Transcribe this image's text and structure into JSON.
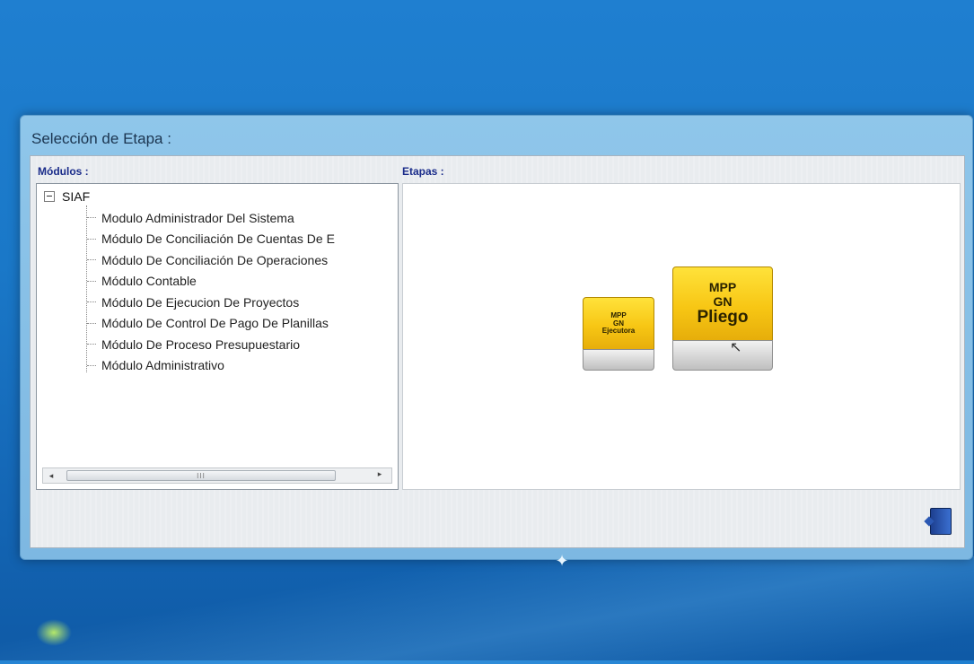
{
  "window": {
    "title": "Selección de Etapa :"
  },
  "modules_panel": {
    "label": "Módulos :",
    "root": "SIAF",
    "items": [
      "Modulo Administrador Del Sistema",
      "Módulo De Conciliación De Cuentas De E",
      "Módulo De Conciliación De Operaciones",
      "Módulo Contable",
      "Módulo De Ejecucion De Proyectos",
      "Módulo De Control De Pago De Planillas",
      "Módulo De Proceso Presupuestario",
      "Módulo Administrativo"
    ],
    "scrollbar": {
      "left_arrow": "◂",
      "thumb_grip": "III",
      "right_arrow": "▸"
    }
  },
  "stages_panel": {
    "label": "Etapas :",
    "buttons": [
      {
        "line1": "MPP",
        "line2": "GN",
        "line3": "Ejecutora"
      },
      {
        "line1": "MPP",
        "line2": "GN",
        "line3": "Pliego"
      }
    ]
  },
  "icons": {
    "exit": "exit-door-icon",
    "pointer": "mouse-pointer-icon",
    "tree_expander": "tree-collapse-icon"
  },
  "colors": {
    "desktop": "#1a78c8",
    "window_frame": "#8fc6ea",
    "label_blue": "#1a2c8a",
    "stage_yellow": "#f7c614"
  }
}
